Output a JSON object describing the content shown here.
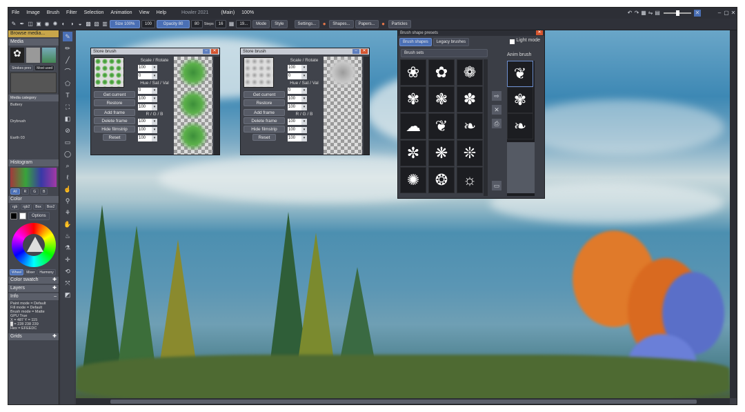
{
  "menu": [
    "File",
    "Image",
    "Brush",
    "Filter",
    "Selection",
    "Animation",
    "View",
    "Help"
  ],
  "title": "Howler 2021",
  "doc": "(Main)",
  "zoom": "100%",
  "toolbar": {
    "size": "Size 100%",
    "size_val": "100",
    "opacity": "Opacity 80",
    "opacity_val": "80",
    "steps_label": "Steps",
    "steps_val": "16",
    "num_val": "19...",
    "mode": "Mode",
    "style": "Style",
    "settings": "Settings...",
    "shapes": "Shapes...",
    "papers": "Papers...",
    "particles": "Particles"
  },
  "left": {
    "media_title": "Media",
    "browse": "Browse media...",
    "tabs": [
      "Strokes prev",
      "Most used"
    ],
    "media_category": "Media category",
    "strokes": [
      "Buttery",
      "Drybrush",
      "Earth 03"
    ],
    "histogram": "Histogram",
    "hist_tabs": [
      "All",
      "R",
      "G",
      "B"
    ],
    "color": "Color",
    "color_tabs": [
      "rgb",
      "rgb2",
      "Box",
      "Box2"
    ],
    "options": "Options",
    "wheel_tabs": [
      "Wheel",
      "Mixer",
      "Harmony"
    ],
    "color_swatch": "Color swatch",
    "layers": "Layers",
    "info": "Info",
    "info_lines": [
      "Paint mode = Default",
      "Fill mode = Default",
      "Brush mode = Matte",
      "GPU  True",
      "X = 487  Y = 115",
      "█ = 228  238  239",
      "Hex = EFEEDC"
    ],
    "grids": "Grids"
  },
  "store1": {
    "title": "Store brush",
    "scale_rotate": "Scale / Rotate",
    "s1": "100",
    "s2": "0",
    "hsv": "Hue / Sat / Val",
    "h1": "0",
    "h2": "100",
    "h3": "100",
    "rgb": "R / G / B",
    "r1": "100",
    "r2": "100",
    "r3": "100",
    "get": "Get current",
    "restore": "Restore",
    "add": "Add frame",
    "delete": "Delete frame",
    "hide": "Hide filmstrip",
    "reset": "Reset"
  },
  "store2": {
    "title": "Store brush",
    "scale_rotate": "Scale / Rotate",
    "s1": "100",
    "s2": "0",
    "hsv": "Hue / Sat / Val",
    "h1": "0",
    "h2": "100",
    "h3": "100",
    "rgb": "R / G / B",
    "r1": "100",
    "r2": "100",
    "r3": "100",
    "get": "Get current",
    "restore": "Restore",
    "add": "Add frame",
    "delete": "Delete frame",
    "hide": "Hide filmstrip",
    "reset": "Reset"
  },
  "presets": {
    "title": "Brush shape presets",
    "tab1": "Brush shapes",
    "tab2": "Legacy brushes",
    "light": "Light mode",
    "sets": "Brush sets",
    "anim": "Anim brush"
  }
}
